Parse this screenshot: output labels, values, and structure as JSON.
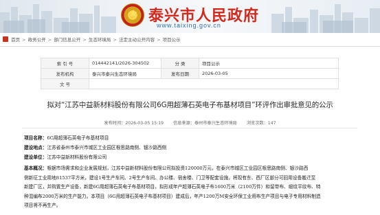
{
  "header": {
    "title": "泰兴市人民政府",
    "url": "www.taixing.gov.cn"
  },
  "breadcrumb": {
    "items": [
      "首页",
      "政务公开",
      "部门信息公开",
      "生态环境局",
      "法定主动公开内容",
      "项目公示"
    ],
    "separator": ">"
  },
  "meta": {
    "index_label": "索 引 号",
    "index_value": "014442141/2026-304502",
    "category_label": "分 类",
    "category_value": "项目公示",
    "publisher_label": "发布机构",
    "publisher_value": "泰兴市泰兴生态环境局",
    "date_label": "发布日期",
    "date_value": "2026-03-05",
    "docno_label": "文 号",
    "docno_value": ""
  },
  "article": {
    "title": "拟对“江苏中益新材料股份有限公司6G用超薄石英电子布基材项目”环评作出审批意见的公示",
    "date_text": "发布时间：2026-03-05 15:19",
    "source_text": "信息来源：泰州市泰兴生态环境局",
    "views_text": "浏览次数：147",
    "project_label": "项目名称：",
    "project_value": "6G用超薄石英电子布基材项目",
    "site_label": "建设地点：",
    "site_value": "江苏省泰州市泰兴市城区工业园区根思路南侧、银沙路西侧",
    "unit_label": "建设单位：",
    "unit_value": "江苏中益新材料股份有限公司",
    "summary_label": "基本概况：",
    "summary_line1": "根据市场需求和企业发展规划，江苏中益新材料股份有限公司拟投资120000万元，在泰兴市城区工业园区根思路南侧、银沙路西",
    "summary_line2": "侧新征工业用地81537平方米，建设1号生产车间、2号生产车间、办公楼、宿舍楼、门卫等配套设施，将现有东、西厂区部分可回用设备搬迁至",
    "summary_line3": "新建厂区，并购置生产设备，新建6G用超薄石英电子布基材项目，拟形成年产超薄石英电子布1600万米（2100万件）和留带布、缎纹平纹布、特",
    "summary_line4": "种混编布2000万米的生产能力。本项目（6G用超薄石英电子布基材项目）建成后，年产1200万M安全环保工业用布生产项目与电子专用材料制造",
    "summary_line5": "项目将不再生产。"
  },
  "colors": {
    "title_red": "#d12a1f",
    "url_blue": "#2f6fb5"
  }
}
